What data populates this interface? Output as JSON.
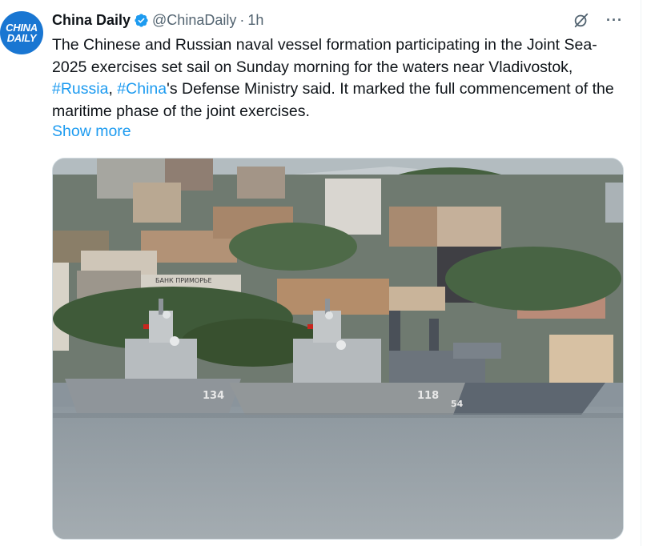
{
  "author": {
    "avatar_line1": "CHINA",
    "avatar_line2": "DAILY",
    "name": "China Daily",
    "handle": "@ChinaDaily",
    "separator": "·",
    "time": "1h",
    "verified_icon": "verified-badge-icon"
  },
  "actions": {
    "grok_icon": "grok-icon",
    "more_label": "···"
  },
  "tweet": {
    "text_part1": "The Chinese and Russian naval vessel formation participating in the Joint Sea-2025 exercises set sail on Sunday morning for the waters near Vladivostok, ",
    "hashtag1": "#Russia",
    "text_part2": ", ",
    "hashtag2": "#China",
    "text_part3": "'s Defense Ministry said. It marked the full commencement of the maritime phase of the joint exercises.",
    "show_more": "Show more"
  },
  "media": {
    "description_icon": "photo-naval-vessels",
    "hull_numbers": [
      "134",
      "118",
      "54"
    ],
    "building_sign": "БАНК ПРИМОРЬЕ"
  },
  "colors": {
    "link": "#1d9bf0",
    "verified": "#1d9bf0",
    "avatar_bg": "#1976d2"
  }
}
